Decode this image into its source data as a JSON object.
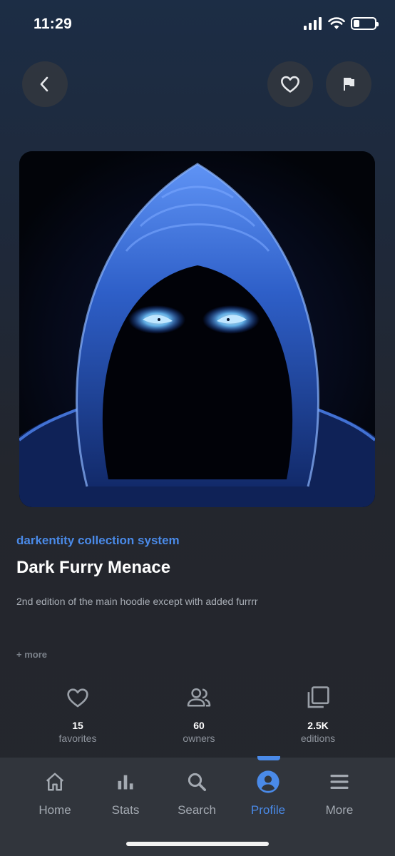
{
  "status_bar": {
    "time": "11:29",
    "battery_level": 0.3
  },
  "header": {
    "back_icon": "chevron-left-icon",
    "favorite_icon": "heart-outline-icon",
    "report_icon": "flag-icon"
  },
  "artwork": {
    "subject": "hooded-figure-glowing-eyes",
    "accent_color": "#3e7bf0"
  },
  "item": {
    "collection": "darkentity collection system",
    "title": "Dark Furry Menace",
    "description": "2nd edition of the main hoodie except with added furrrr",
    "more_label": "+ more"
  },
  "stats": [
    {
      "icon": "heart-outline-icon",
      "value": "15",
      "label": "favorites"
    },
    {
      "icon": "people-icon",
      "value": "60",
      "label": "owners"
    },
    {
      "icon": "editions-stack-icon",
      "value": "2.5K",
      "label": "editions"
    }
  ],
  "nav": {
    "active": "Profile",
    "items": [
      {
        "label": "Home",
        "icon": "home-icon"
      },
      {
        "label": "Stats",
        "icon": "bar-chart-icon"
      },
      {
        "label": "Search",
        "icon": "search-icon"
      },
      {
        "label": "Profile",
        "icon": "profile-icon"
      },
      {
        "label": "More",
        "icon": "menu-icon"
      }
    ]
  },
  "colors": {
    "accent": "#4a8ae8",
    "background": "#25272d",
    "nav_background": "#31353c"
  }
}
